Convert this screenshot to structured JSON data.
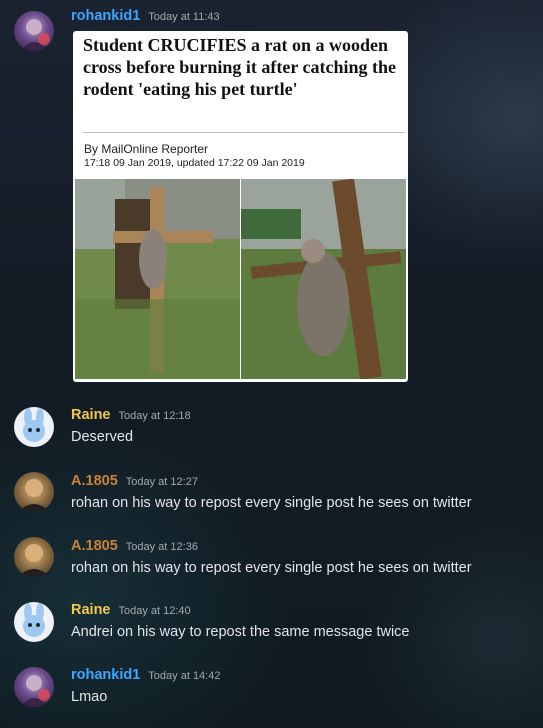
{
  "messages": [
    {
      "author": "rohankid1",
      "timestamp": "Today at 11:43",
      "attachment": {
        "headline": "Student CRUCIFIES a rat on a wooden cross before burning it after catching the rodent 'eating his pet turtle'",
        "byline": "By MailOnline Reporter",
        "dateline": "17:18 09 Jan 2019, updated 17:22 09 Jan 2019"
      }
    },
    {
      "author": "Raine",
      "timestamp": "Today at 12:18",
      "text": "Deserved"
    },
    {
      "author": "A.1805",
      "timestamp": "Today at 12:27",
      "text": "rohan on his way to repost every single post he sees on twitter"
    },
    {
      "author": "A.1805",
      "timestamp": "Today at 12:36",
      "text": "rohan on his way to repost every single post he sees on twitter"
    },
    {
      "author": "Raine",
      "timestamp": "Today at 12:40",
      "text": "Andrei on his way to repost the same message twice"
    },
    {
      "author": "rohankid1",
      "timestamp": "Today at 14:42",
      "text": "Lmao"
    }
  ],
  "colors": {
    "rohankid1": "#3ea6ff",
    "Raine": "#f0c84b",
    "A.1805": "#c9823b",
    "timestamp": "#a4a8ad",
    "message_text": "#e3e5e8"
  },
  "icons": {
    "rohankid1_avatar": "user-avatar-icon",
    "Raine_avatar": "bunny-mascot-avatar-icon",
    "A.1805_avatar": "user-photo-avatar-icon"
  }
}
